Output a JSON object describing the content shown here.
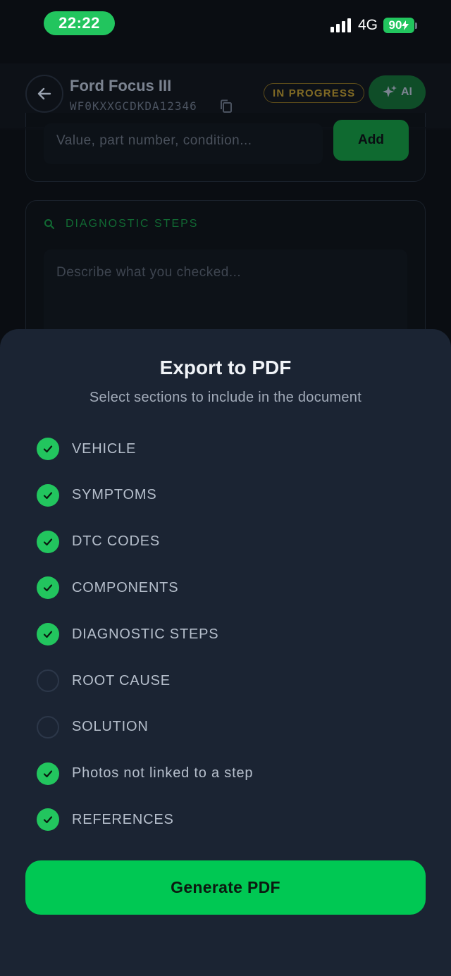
{
  "status_bar": {
    "time": "22:22",
    "network": "4G",
    "battery": "90"
  },
  "header": {
    "title": "Ford Focus III",
    "vin": "WF0KXXGCDKDA12346",
    "status_badge": "IN PROGRESS",
    "ai_button": "AI"
  },
  "background": {
    "value_placeholder": "Value, part number, condition...",
    "add_button": "Add",
    "diagnostic_label": "DIAGNOSTIC STEPS",
    "diagnostic_placeholder": "Describe what you checked..."
  },
  "sheet": {
    "title": "Export to PDF",
    "subtitle": "Select sections to include in the document",
    "options": [
      {
        "label": "VEHICLE",
        "checked": true
      },
      {
        "label": "SYMPTOMS",
        "checked": true
      },
      {
        "label": "DTC CODES",
        "checked": true
      },
      {
        "label": "COMPONENTS",
        "checked": true
      },
      {
        "label": "DIAGNOSTIC STEPS",
        "checked": true
      },
      {
        "label": "ROOT CAUSE",
        "checked": false
      },
      {
        "label": "SOLUTION",
        "checked": false
      },
      {
        "label": "Photos not linked to a step",
        "checked": true
      },
      {
        "label": "REFERENCES",
        "checked": true
      }
    ],
    "generate_button": "Generate PDF"
  },
  "colors": {
    "accent": "#22c55e",
    "sheet_bg": "#1b2433",
    "button": "#00c853"
  }
}
